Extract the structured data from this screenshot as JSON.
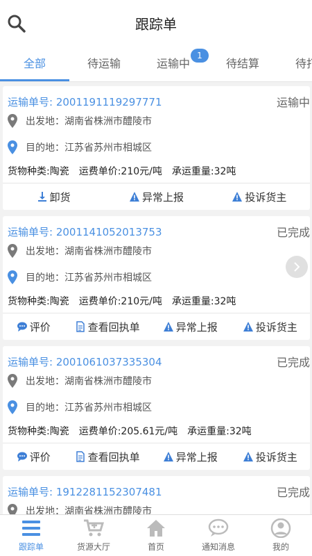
{
  "header": {
    "title": "跟踪单"
  },
  "tabs": [
    {
      "label": "全部",
      "active": true
    },
    {
      "label": "待运输"
    },
    {
      "label": "运输中",
      "badge": "1"
    },
    {
      "label": "待结算"
    },
    {
      "label": "待打"
    }
  ],
  "orders": [
    {
      "order_label": "运输单号: 2001191119297771",
      "status": "运输中",
      "origin": "出发地：湖南省株洲市醴陵市",
      "destination": "目的地：江苏省苏州市相城区",
      "cargo": "货物种类:陶瓷",
      "price": "运费单价:210元/吨",
      "weight": "承运重量:32吨",
      "actions": [
        "卸货",
        "异常上报",
        "投诉货主"
      ]
    },
    {
      "order_label": "运输单号: 2001141052013753",
      "status": "已完成",
      "origin": "出发地：湖南省株洲市醴陵市",
      "destination": "目的地：江苏省苏州市相城区",
      "cargo": "货物种类:陶瓷",
      "price": "运费单价:210元/吨",
      "weight": "承运重量:32吨",
      "actions": [
        "评价",
        "查看回执单",
        "异常上报",
        "投诉货主"
      ]
    },
    {
      "order_label": "运输单号: 2001061037335304",
      "status": "已完成",
      "origin": "出发地：湖南省株洲市醴陵市",
      "destination": "目的地：江苏省苏州市相城区",
      "cargo": "货物种类:陶瓷",
      "price": "运费单价:205.61元/吨",
      "weight": "承运重量:32吨",
      "actions": [
        "评价",
        "查看回执单",
        "异常上报",
        "投诉货主"
      ]
    },
    {
      "order_label": "运输单号: 1912281152307481",
      "status": "已完成",
      "origin": "出发地：湖南省株洲市醴陵市"
    }
  ],
  "nav": [
    {
      "label": "跟踪单",
      "icon": "menu-icon",
      "active": true
    },
    {
      "label": "货源大厅",
      "icon": "cart-icon"
    },
    {
      "label": "首页",
      "icon": "home-icon"
    },
    {
      "label": "通知消息",
      "icon": "message-icon"
    },
    {
      "label": "我的",
      "icon": "user-icon"
    }
  ],
  "colors": {
    "accent": "#4a90e2",
    "pin_gray": "#7a7a7a",
    "warn": "#3e7fd6"
  }
}
